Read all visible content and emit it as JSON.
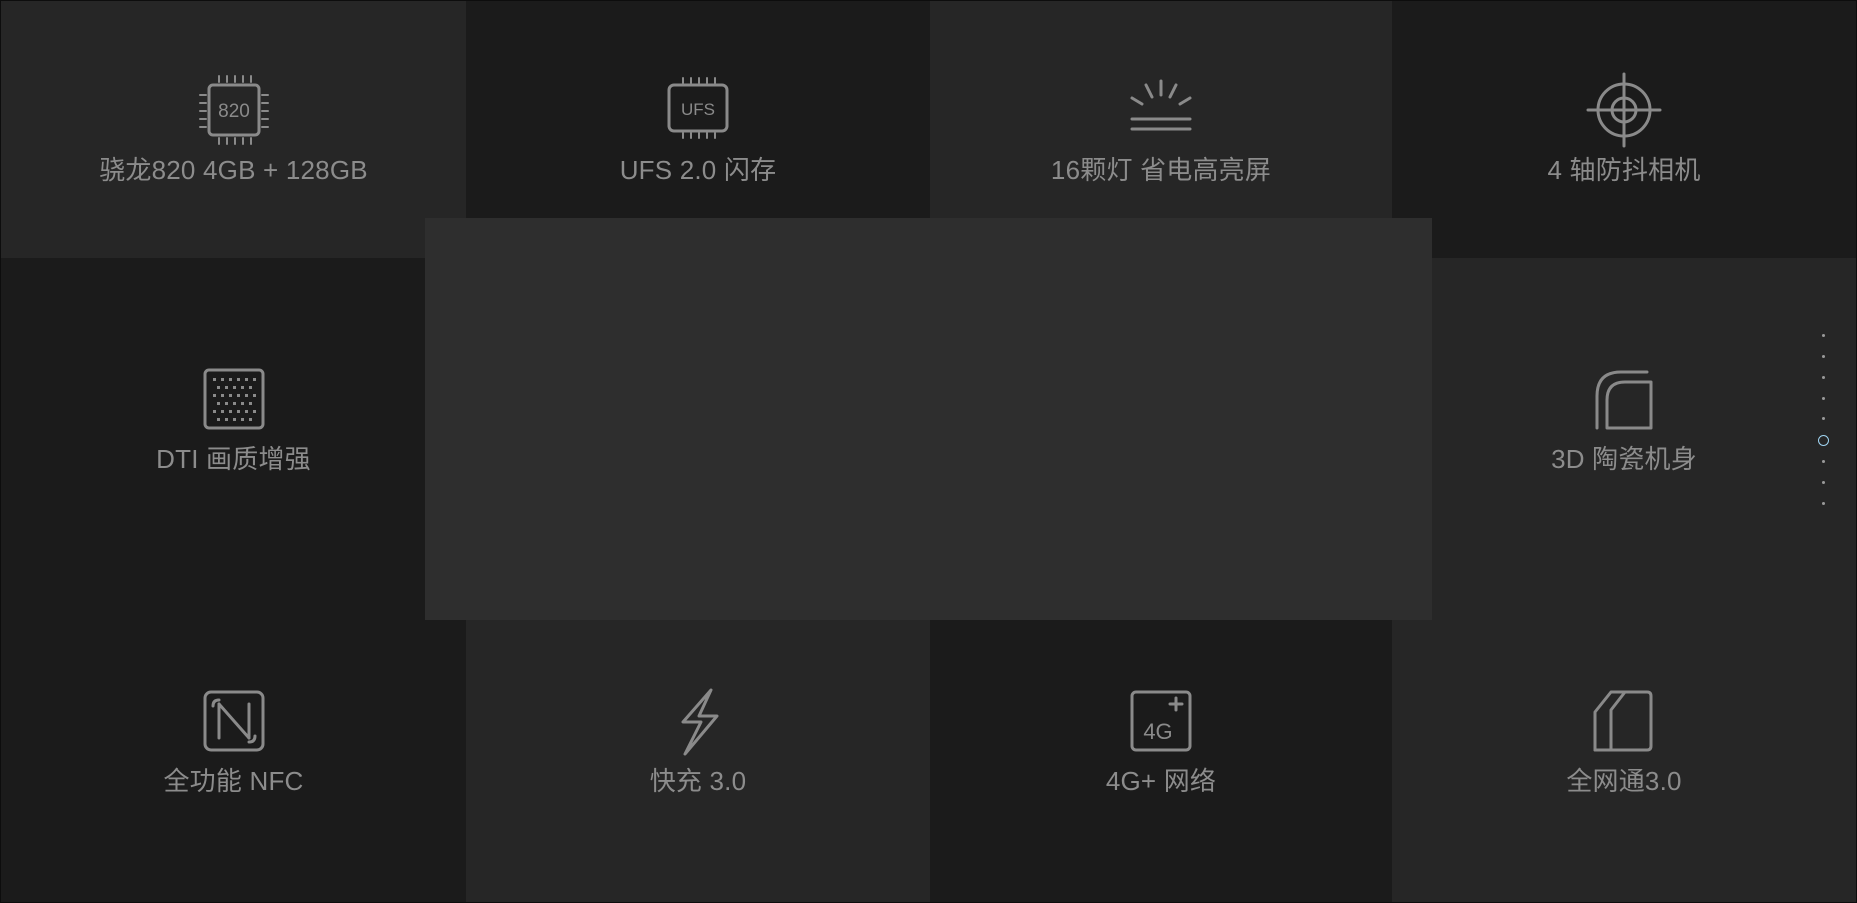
{
  "features": [
    {
      "label": "骁龙820 4GB + 128GB",
      "icon": "chip-820-icon",
      "chip_text": "820"
    },
    {
      "label": "UFS 2.0 闪存",
      "icon": "ufs-chip-icon",
      "chip_text": "UFS"
    },
    {
      "label": "16颗灯 省电高亮屏",
      "icon": "screen-light-icon"
    },
    {
      "label": "4 轴防抖相机",
      "icon": "crosshair-icon"
    },
    {
      "label": "DTI 画质增强",
      "icon": "pixel-grid-icon"
    },
    {
      "label": "3D 陶瓷机身",
      "icon": "ceramic-curve-icon"
    },
    {
      "label": "全功能 NFC",
      "icon": "nfc-icon"
    },
    {
      "label": "快充 3.0",
      "icon": "lightning-icon"
    },
    {
      "label": "4G+ 网络",
      "icon": "4g-plus-icon",
      "chip_text": "4G"
    },
    {
      "label": "全网通3.0",
      "icon": "dual-sim-icon"
    }
  ],
  "dot_nav": {
    "count": 9,
    "active_index": 5
  },
  "colors": {
    "background": "#1e1e1e",
    "tile_light": "#262626",
    "tile_dark": "#1b1b1b",
    "overlay": "#2e2e2e",
    "text": "#8c8c8c",
    "accent": "#9fd3f0"
  }
}
